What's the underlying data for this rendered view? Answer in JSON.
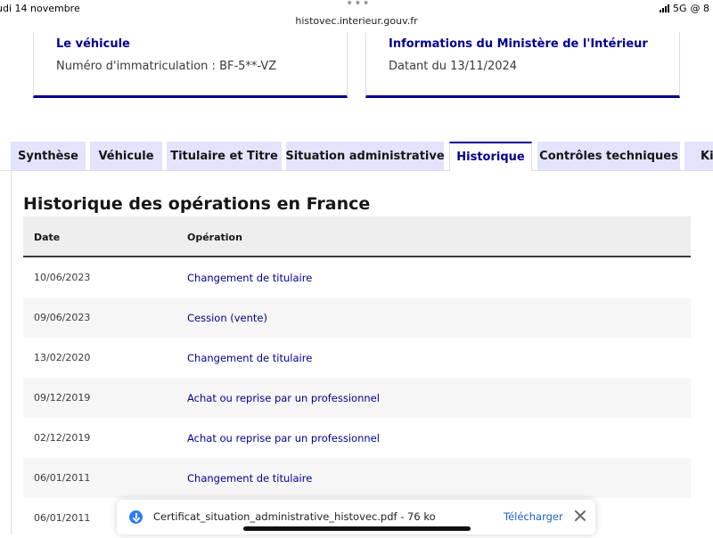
{
  "status_bar": {
    "date": "udi 14 novembre",
    "dots": "•••",
    "url": "histovec.interieur.gouv.fr",
    "network": "5G",
    "right_extra": "@ 8"
  },
  "cards": [
    {
      "title": "Le véhicule",
      "text": "Numéro d'immatriculation : BF-5**-VZ"
    },
    {
      "title": "Informations du Ministère de l'Intérieur",
      "text": "Datant du 13/11/2024"
    }
  ],
  "tabs": [
    {
      "label": "Synthèse",
      "active": false
    },
    {
      "label": "Véhicule",
      "active": false
    },
    {
      "label": "Titulaire et Titre",
      "active": false
    },
    {
      "label": "Situation administrative",
      "active": false
    },
    {
      "label": "Historique",
      "active": true
    },
    {
      "label": "Contrôles techniques",
      "active": false
    },
    {
      "label": "Kilo",
      "active": false
    }
  ],
  "section": {
    "title": "Historique des opérations en France"
  },
  "table": {
    "headers": {
      "date": "Date",
      "operation": "Opération"
    },
    "rows": [
      {
        "date": "10/06/2023",
        "operation": "Changement de titulaire"
      },
      {
        "date": "09/06/2023",
        "operation": "Cession (vente)"
      },
      {
        "date": "13/02/2020",
        "operation": "Changement de titulaire"
      },
      {
        "date": "09/12/2019",
        "operation": "Achat ou reprise par un professionnel"
      },
      {
        "date": "02/12/2019",
        "operation": "Achat ou reprise par un professionnel"
      },
      {
        "date": "06/01/2011",
        "operation": "Changement de titulaire"
      },
      {
        "date": "06/01/2011",
        "operation": ""
      }
    ]
  },
  "download_bar": {
    "file": "Certificat_situation_administrative_histovec.pdf - 76 ko",
    "action": "Télécharger",
    "icon": "download-icon"
  },
  "colors": {
    "accent": "#000091",
    "tab_bg": "#e3e3fd",
    "link": "#1a64c9"
  }
}
